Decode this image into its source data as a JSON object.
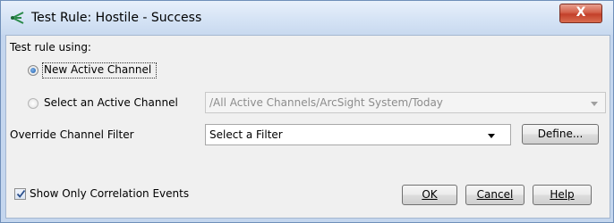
{
  "window": {
    "title": "Test Rule: Hostile - Success",
    "close_label": "X"
  },
  "form": {
    "test_rule_label": "Test rule using:",
    "option_new_channel": "New Active Channel",
    "option_select_channel": "Select an Active Channel",
    "selected_option": "New Active Channel",
    "active_channel_value": "/All Active Channels/ArcSight System/Today",
    "override_filter_label": "Override Channel Filter",
    "filter_value": "Select a Filter",
    "define_button": "Define...",
    "show_correlation_label": "Show Only Correlation Events",
    "show_correlation_checked": true
  },
  "buttons": {
    "ok": "OK",
    "cancel": "Cancel",
    "help": "Help"
  },
  "colors": {
    "title_icon": "#2a8a4a",
    "close_button": "#c3402a"
  }
}
